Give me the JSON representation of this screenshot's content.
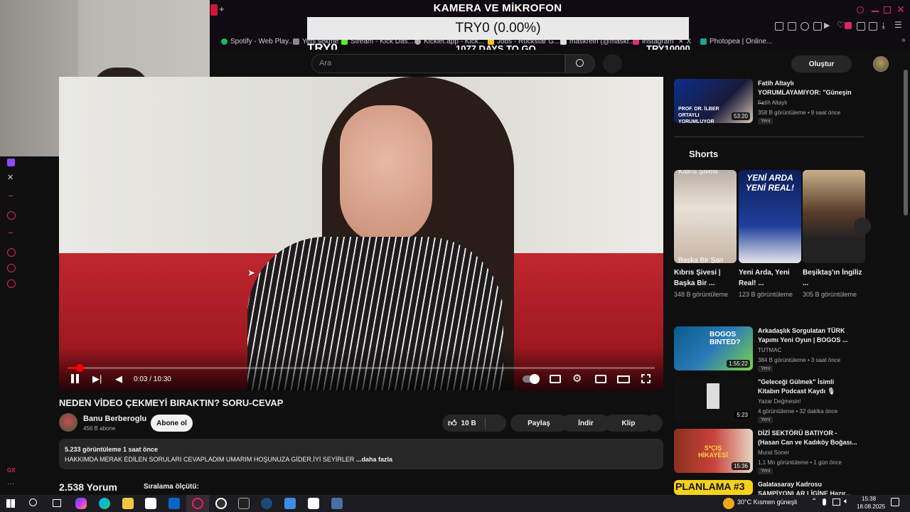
{
  "overlay": {
    "title": "KAMERA VE MİKROFON",
    "progress_text": "TRY0 (0.00%)",
    "left_label": "TRY0",
    "center_label": "1077 DAYS TO GO",
    "right_label": "TRY10000"
  },
  "browser": {
    "bookmarks": [
      {
        "label": "Spotify - Web Play...",
        "color": "#1db954"
      },
      {
        "label": "Yeni sekme",
        "color": "#888888"
      },
      {
        "label": "Stream - Kick Das...",
        "color": "#53fc18"
      },
      {
        "label": "Kicklet.app - Kick...",
        "color": "#aaaaaa"
      },
      {
        "label": "Jobs - Rockstar G...",
        "color": "#f5c518"
      },
      {
        "label": "maskrein (@maskr...",
        "color": "#dddddd"
      },
      {
        "label": "Instagram",
        "color": "#e1306c"
      },
      {
        "label": "X",
        "color": "#ffffff"
      },
      {
        "label": "Photopea | Online...",
        "color": "#18a497"
      }
    ]
  },
  "header": {
    "search_placeholder": "Ara",
    "create_label": "Oluştur"
  },
  "player": {
    "time": "0:03 / 10:30",
    "progress_fraction": 0.005
  },
  "video": {
    "title": "NEDEN VİDEO ÇEKMEYİ BIRAKTIN? SORU-CEVAP",
    "channel": "Banu Berberoglu",
    "subscribers": "456 B abone",
    "subscribe_label": "Abone ol",
    "likes": "10 B",
    "share_label": "Paylaş",
    "download_label": "İndir",
    "clip_label": "Klip",
    "views_line": "5.233 görüntüleme  1 saat önce",
    "description": "HAKKIMDA MERAK EDİLEN SORULARI CEVAPLADIM  UMARIM HOŞUNUZA GİDER.İYİ SEYİRLER",
    "more_label": "...daha fazla",
    "comments_count": "2.538 Yorum",
    "sort_label": "Sıralama ölçütü:"
  },
  "sidebar": {
    "top_video": {
      "title": "Fatih Altaylı YORUMLAYAMIYOR: \"Güneşin ...",
      "channel": "Fatih Altaylı",
      "meta": "358 B görüntüleme • 9 saat önce",
      "badge": "Yeni",
      "duration": "53:20",
      "thumb_text": "PROF. DR. İLBER ORTAYLI YORUMLUYOR"
    },
    "shorts_heading": "Shorts",
    "shorts": [
      {
        "title": "Kıbrıs Şivesi | Başka Bir ...",
        "views": "348 B görüntüleme",
        "thumb_top": "Kıbrıs Şivesi",
        "thumb_bottom": "Başka Bir Şan"
      },
      {
        "title": "Yeni Arda, Yeni Real! ...",
        "views": "123 B görüntüleme",
        "thumb_top": "YENİ ARDA YENİ REAL!",
        "thumb_bottom": ""
      },
      {
        "title": "Beşiktaş'ın İngiliz ...",
        "views": "305 B görüntüleme",
        "thumb_top": "",
        "thumb_bottom": ""
      }
    ],
    "videos": [
      {
        "title": "Arkadaşlık Sorgulatan TÜRK Yapımı Yeni Oyun | BOGOS ...",
        "channel": "TUTMAC",
        "meta": "384 B görüntüleme • 3 saat önce",
        "badge": "Yeni",
        "duration": "1:55:22",
        "thumb_text": "BOGOS BINTED?"
      },
      {
        "title": "\"Geleceği Gülmek\" İsimli Kitabın Podcast Kaydı 🎙",
        "channel": "Yazar Değmesin!",
        "meta": "4 görüntüleme • 32 dakika önce",
        "badge": "Yeni",
        "duration": "5:23",
        "thumb_text": ""
      },
      {
        "title": "DİZİ SEKTÖRÜ BATIYOR - (Hasan Can ve Kadıköy Boğası...",
        "channel": "Murat Soner",
        "meta": "1,1 Mn görüntüleme • 1 gün önce",
        "badge": "Yeni",
        "duration": "15:36",
        "thumb_text": "S*ÇIŞ HİKAYESİ"
      },
      {
        "title": "Galatasaray Kadrosu ŞAMPİYONLAR LİGİNE Hazır...",
        "channel": "",
        "meta": "",
        "badge": "",
        "duration": "",
        "thumb_text": "PLANLAMA #3"
      }
    ]
  },
  "taskbar": {
    "weather": "30°C  Kısmen güneşli",
    "time": "15:38",
    "date": "18.08.2025"
  }
}
